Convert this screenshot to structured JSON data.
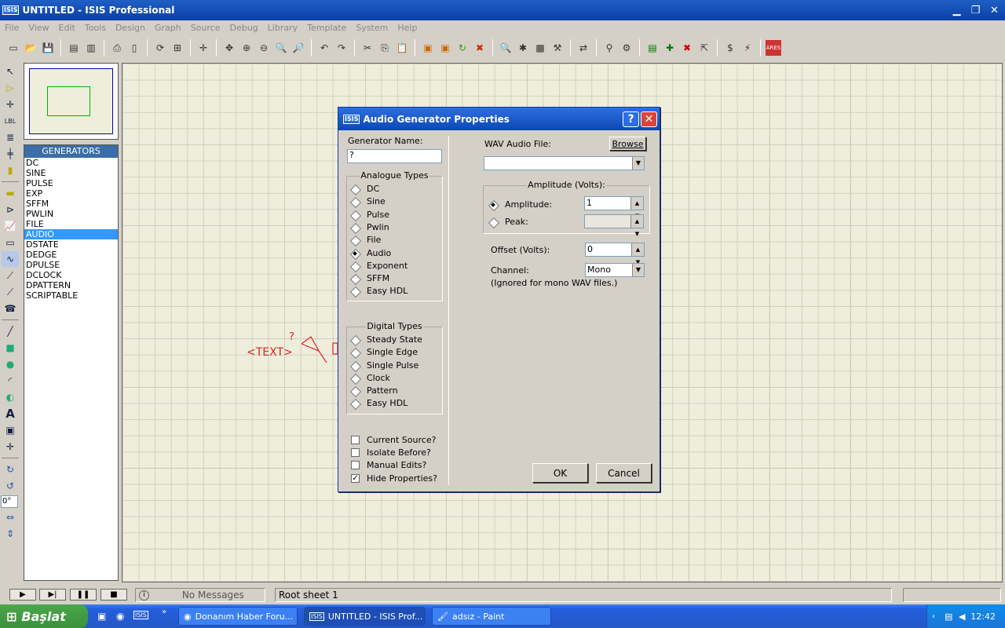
{
  "window": {
    "title": "UNTITLED - ISIS Professional",
    "icon_label": "ISIS"
  },
  "menu": [
    "File",
    "View",
    "Edit",
    "Tools",
    "Design",
    "Graph",
    "Source",
    "Debug",
    "Library",
    "Template",
    "System",
    "Help"
  ],
  "generators": {
    "header": "GENERATORS",
    "items": [
      "DC",
      "SINE",
      "PULSE",
      "EXP",
      "SFFM",
      "PWLIN",
      "FILE",
      "AUDIO",
      "DSTATE",
      "DEDGE",
      "DPULSE",
      "DCLOCK",
      "DPATTERN",
      "SCRIPTABLE"
    ],
    "selected": "AUDIO"
  },
  "canvas": {
    "text_label": "<TEXT>",
    "question": "?"
  },
  "dialog": {
    "title": "Audio Generator Properties",
    "help": "?",
    "close": "✕",
    "generator_name_label": "Generator Name:",
    "generator_name_value": "?",
    "analogue_title": "Analogue Types",
    "analogue": [
      "DC",
      "Sine",
      "Pulse",
      "Pwlin",
      "File",
      "Audio",
      "Exponent",
      "SFFM",
      "Easy HDL"
    ],
    "analogue_selected": "Audio",
    "digital_title": "Digital Types",
    "digital": [
      "Steady State",
      "Single Edge",
      "Single Pulse",
      "Clock",
      "Pattern",
      "Easy HDL"
    ],
    "checks": [
      {
        "label": "Current Source?",
        "checked": false
      },
      {
        "label": "Isolate Before?",
        "checked": false
      },
      {
        "label": "Manual Edits?",
        "checked": false
      },
      {
        "label": "Hide Properties?",
        "checked": true
      }
    ],
    "wav_label": "WAV Audio File:",
    "browse": "Browse",
    "wav_value": "",
    "amplitude_group": "Amplitude (Volts):",
    "amplitude_label": "Amplitude:",
    "amplitude_value": "1",
    "peak_label": "Peak:",
    "peak_value": "",
    "amplitude_mode": "Amplitude",
    "offset_label": "Offset (Volts):",
    "offset_value": "0",
    "channel_label": "Channel:",
    "channel_value": "Mono",
    "channel_note": "(Ignored for mono WAV files.)",
    "ok": "OK",
    "cancel": "Cancel"
  },
  "status": {
    "messages": "No Messages",
    "sheet": "Root sheet 1",
    "rotation": "0°",
    "info_icon": "i"
  },
  "taskbar": {
    "start": "Başlat",
    "tasks": [
      "Donanım Haber Foru...",
      "UNTITLED - ISIS Prof...",
      "adsız - Paint"
    ],
    "time": "12:42"
  }
}
